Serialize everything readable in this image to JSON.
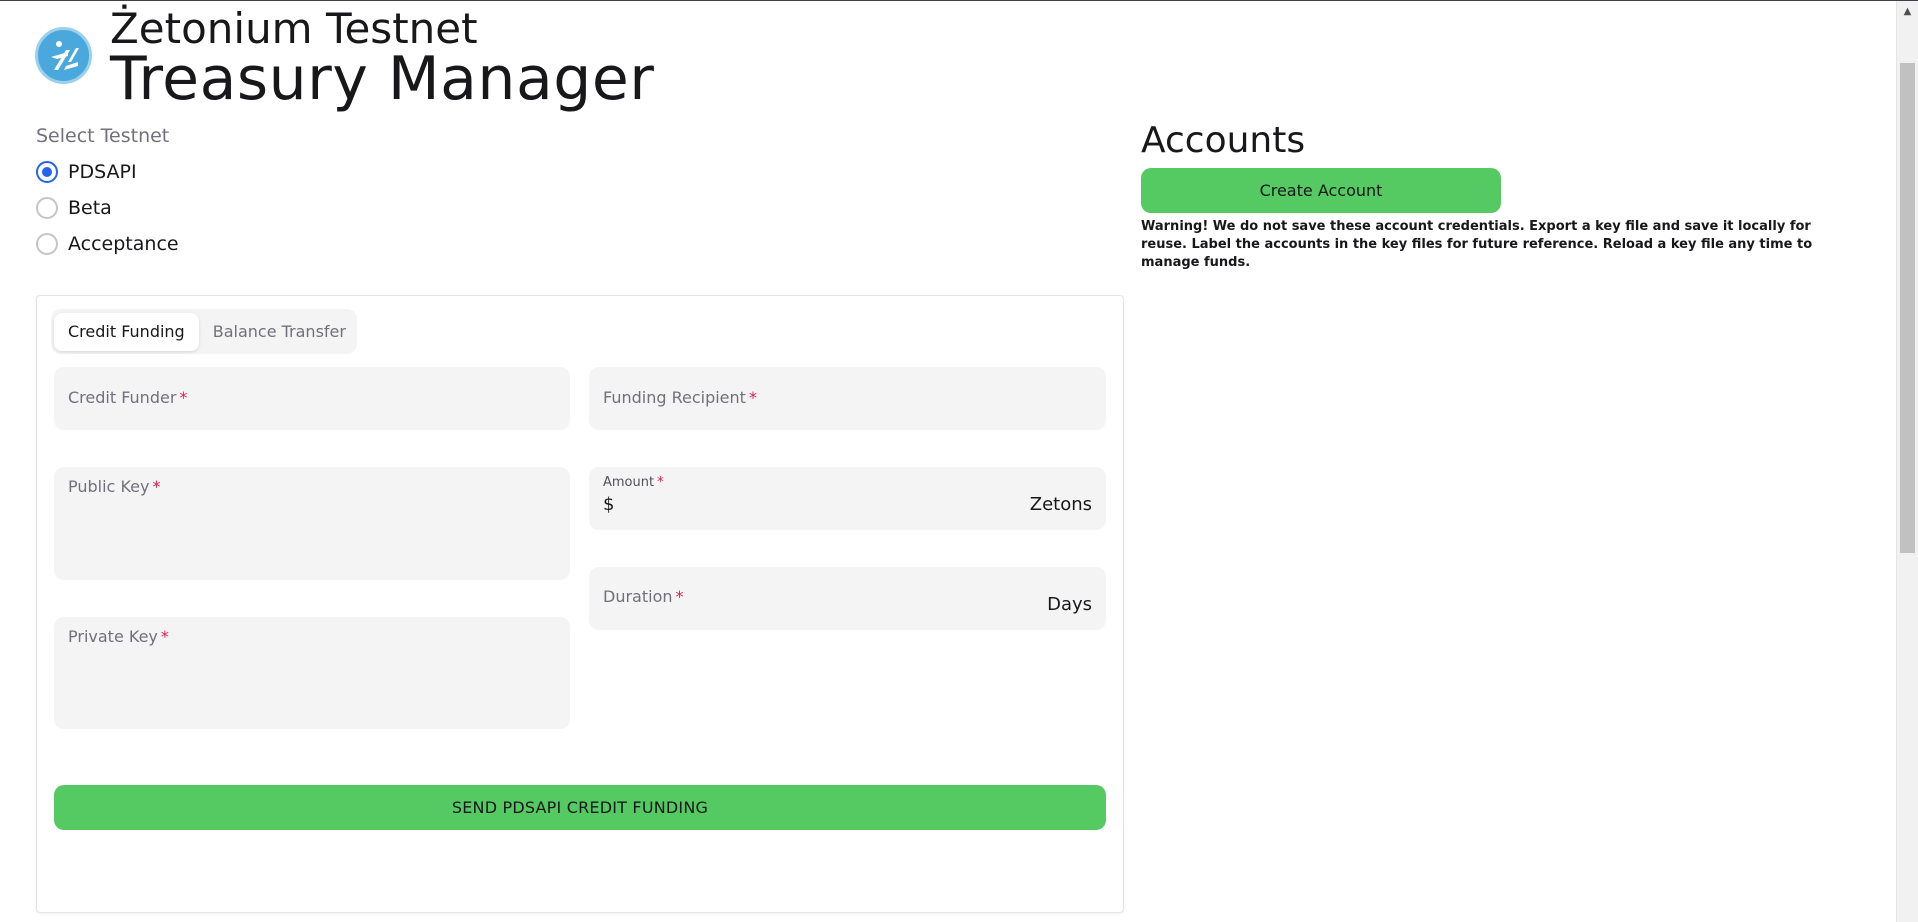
{
  "header": {
    "title_line1": "Żetonium Testnet",
    "title_line2": "Treasury Manager",
    "logo_icon": "zetonium-logo-icon"
  },
  "testnet": {
    "label": "Select Testnet",
    "options": [
      "PDSAPI",
      "Beta",
      "Acceptance"
    ],
    "selected": "PDSAPI"
  },
  "tabs": [
    "Credit Funding",
    "Balance Transfer"
  ],
  "form": {
    "credit_funder": "Credit Funder",
    "funding_recipient": "Funding Recipient",
    "public_key": "Public Key",
    "private_key": "Private Key",
    "amount_label": "Amount",
    "amount_prefix": "$",
    "amount_suffix": "Zetons",
    "duration_label": "Duration",
    "duration_suffix": "Days",
    "required_mark": "*",
    "submit_label": "SEND PDSAPI CREDIT FUNDING"
  },
  "accounts": {
    "title": "Accounts",
    "create_label": "Create Account",
    "warning": "Warning! We do not save these account credentials. Export a key file and save it locally for reuse. Label the accounts in the key files for future reference. Reload a key file any time to manage funds."
  },
  "colors": {
    "accent_green": "#55c962",
    "radio_blue": "#2563eb",
    "required_red": "#e11d48",
    "logo_blue": "#4aa8dc"
  }
}
